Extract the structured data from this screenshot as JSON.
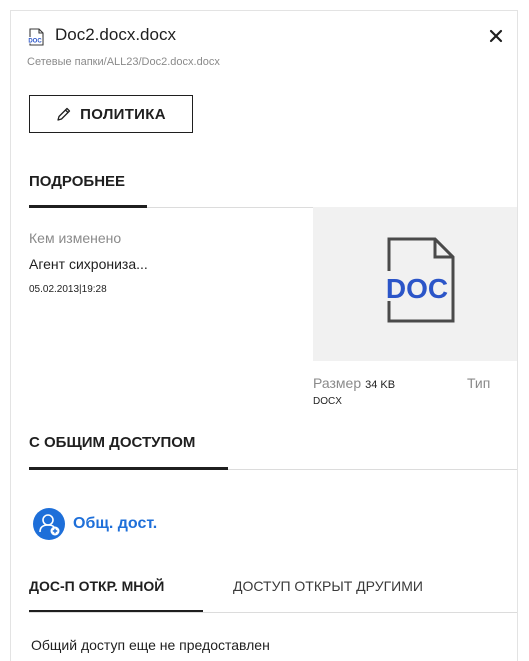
{
  "header": {
    "file_name": "Doc2.docx.docx",
    "file_path": "Сетевые папки/ALL23/Doc2.docx.docx",
    "file_icon_text": "DOC",
    "close_icon": "close-icon"
  },
  "policy": {
    "label": "ПОЛИТИКА",
    "icon": "pencil-icon"
  },
  "details": {
    "title": "ПОДРОБНЕЕ",
    "modified_by_label": "Кем изменено",
    "modified_by_value": "Агент сихрониза...",
    "modified_date": "05.02.2013|19:28",
    "preview_text": "DOC",
    "size_label": "Размер",
    "size_value": "34 KB",
    "type_label": "Тип",
    "type_value": "DOCX"
  },
  "sharing": {
    "title": "С ОБЩИМ ДОСТУПОМ",
    "share_button_label": "Общ. дост.",
    "share_icon": "add-user-icon",
    "tabs": [
      {
        "label": "ДОС-П ОТКР. МНОЙ",
        "active": true
      },
      {
        "label": "ДОСТУП ОТКРЫТ ДРУГИМИ",
        "active": false
      }
    ],
    "empty_message": "Общий доступ еще не предоставлен"
  },
  "colors": {
    "accent": "#1e6fd9",
    "doc_blue": "#2b55c8",
    "text": "#1f1f1f",
    "muted": "#8a8a8a"
  }
}
